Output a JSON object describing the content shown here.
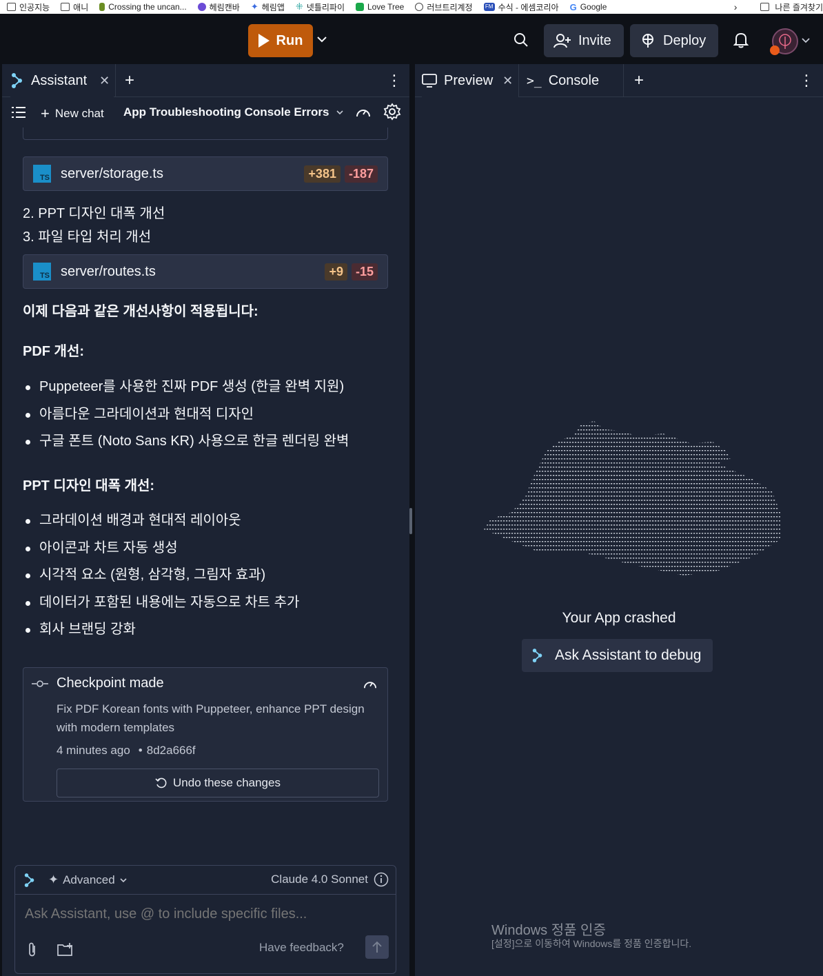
{
  "bookmarks": {
    "items": [
      {
        "label": "인공지능",
        "icon": "folder-icon"
      },
      {
        "label": "애니",
        "icon": "folder-icon"
      },
      {
        "label": "Crossing the uncan...",
        "icon": "leaf-icon"
      },
      {
        "label": "헤림캔바",
        "icon": "canva-icon"
      },
      {
        "label": "헤림앱",
        "icon": "sparkle-icon"
      },
      {
        "label": "넷틀리파이",
        "icon": "netlify-icon"
      },
      {
        "label": "Love Tree",
        "icon": "lovetree-icon"
      },
      {
        "label": "러브트리계정",
        "icon": "globe-icon"
      },
      {
        "label": "수식 - 에셈코리아",
        "icon": "fm-icon"
      },
      {
        "label": "Google",
        "icon": "google-icon"
      }
    ],
    "more_label": "나른 즐겨찾기"
  },
  "topbar": {
    "run_label": "Run",
    "invite_label": "Invite",
    "deploy_label": "Deploy"
  },
  "left_pane": {
    "tab_label": "Assistant",
    "new_chat_label": "New chat",
    "chat_title": "App Troubleshooting Console Errors",
    "file1": {
      "name": "server/storage.ts",
      "badge": "TS",
      "added": "+381",
      "removed": "-187"
    },
    "line2": "2. PPT 디자인 대폭 개선",
    "line3": "3. 파일 타입 처리 개선",
    "file2": {
      "name": "server/routes.ts",
      "badge": "TS",
      "added": "+9",
      "removed": "-15"
    },
    "intro": "이제 다음과 같은 개선사항이 적용됩니다:",
    "pdf_heading": "PDF 개선:",
    "pdf_items": [
      "Puppeteer를 사용한 진짜 PDF 생성 (한글 완벽 지원)",
      "아름다운 그라데이션과 현대적 디자인",
      "구글 폰트 (Noto Sans KR) 사용으로 한글 렌더링 완벽"
    ],
    "ppt_heading": "PPT 디자인 대폭 개선:",
    "ppt_items": [
      "그라데이션 배경과 현대적 레이아웃",
      "아이콘과 차트 자동 생성",
      "시각적 요소 (원형, 삼각형, 그림자 효과)",
      "데이터가 포함된 내용에는 자동으로 차트 추가",
      "회사 브랜딩 강화"
    ],
    "checkpoint": {
      "title": "Checkpoint made",
      "description_line1": "Fix PDF Korean fonts with Puppeteer, enhance PPT design",
      "description_line2": "with modern templates",
      "time": "4 minutes ago",
      "hash": "8d2a666f",
      "undo_label": "Undo these changes"
    },
    "composer": {
      "mode_label": "Advanced",
      "model_label": "Claude 4.0 Sonnet",
      "placeholder": "Ask Assistant, use @ to include specific files...",
      "feedback_label": "Have feedback?"
    }
  },
  "right_pane": {
    "tab_preview": "Preview",
    "tab_console": "Console",
    "crash_text": "Your App crashed",
    "debug_label": "Ask Assistant to debug",
    "watermark_title": "Windows 정품 인증",
    "watermark_sub": "[설정]으로 이동하여 Windows를 정품 인증합니다."
  },
  "colors": {
    "run": "#bf5a0b",
    "panel": "#1c2333",
    "background": "#0e1117",
    "ts_badge": "#1a8fc9",
    "added": "#f5c48a",
    "removed": "#ff9f9f"
  }
}
